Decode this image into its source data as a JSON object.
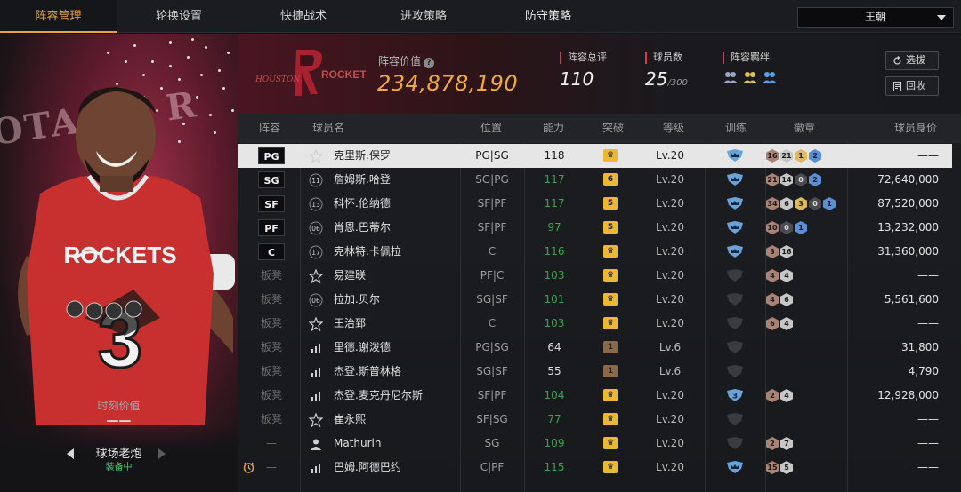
{
  "nav": {
    "tabs": [
      "阵容管理",
      "轮换设置",
      "快捷战术",
      "进攻策略",
      "防守策略"
    ],
    "active_tab": 0,
    "team_select": "王朝"
  },
  "player_card": {
    "background_text": "OTA CE   R",
    "jersey_text": "ROCKETS",
    "jersey_number": "3",
    "moment_value_label": "时刻价值",
    "moment_value": "——",
    "card_name": "球场老炮",
    "status": "装备中"
  },
  "team_header": {
    "logo_text": "HOUSTON ROCKETS",
    "lineup_value_label": "阵容价值",
    "lineup_value": "234,878,190",
    "overall_label": "阵容总评",
    "overall_value": "110",
    "players_label": "球员数",
    "players_value": "25",
    "players_max": "/300",
    "chemistry_label": "阵容羁绊",
    "scout_button": "选拔",
    "recycle_button": "回收"
  },
  "table": {
    "headers": {
      "slot": "阵容",
      "name": "球员名",
      "position": "位置",
      "ability": "能力",
      "breakthrough": "突破",
      "level": "等级",
      "training": "训练",
      "badges": "徽章",
      "value": "球员身价"
    },
    "rows": [
      {
        "slot": "PG",
        "starter": true,
        "tier": "star",
        "name": "克里斯.保罗",
        "pos": "PG|SG",
        "ovr": "118",
        "ovr_color": "white",
        "brk": "crown",
        "brk_color": "gold",
        "lvl": "Lv.20",
        "trn": "crown",
        "badges": [
          [
            "16",
            "b-bronze"
          ],
          [
            "21",
            "b-silver"
          ],
          [
            "1",
            "b-gold"
          ],
          [
            "2",
            "b-blue"
          ]
        ],
        "value": "——",
        "selected": true
      },
      {
        "slot": "SG",
        "starter": true,
        "tier": "11",
        "name": "詹姆斯.哈登",
        "pos": "SG|PG",
        "ovr": "117",
        "ovr_color": "green",
        "brk": "6",
        "brk_color": "gold",
        "lvl": "Lv.20",
        "trn": "crown",
        "badges": [
          [
            "21",
            "b-bronze"
          ],
          [
            "14",
            "b-silver"
          ],
          [
            "0",
            "b-dark"
          ],
          [
            "2",
            "b-blue"
          ]
        ],
        "value": "72,640,000"
      },
      {
        "slot": "SF",
        "starter": true,
        "tier": "13",
        "name": "科怀.伦纳德",
        "pos": "SF|PF",
        "ovr": "117",
        "ovr_color": "green",
        "brk": "5",
        "brk_color": "gold",
        "lvl": "Lv.20",
        "trn": "crown",
        "badges": [
          [
            "34",
            "b-bronze"
          ],
          [
            "6",
            "b-silver"
          ],
          [
            "3",
            "b-gold"
          ],
          [
            "0",
            "b-dark"
          ],
          [
            "1",
            "b-blue"
          ]
        ],
        "value": "87,520,000"
      },
      {
        "slot": "PF",
        "starter": true,
        "tier": "06",
        "name": "肖恩.巴蒂尔",
        "pos": "SF|PF",
        "ovr": "97",
        "ovr_color": "green",
        "brk": "5",
        "brk_color": "gold",
        "lvl": "Lv.20",
        "trn": "crown",
        "badges": [
          [
            "10",
            "b-bronze"
          ],
          [
            "0",
            "b-dark"
          ],
          [
            "1",
            "b-blue"
          ]
        ],
        "value": "13,232,000"
      },
      {
        "slot": "C",
        "starter": true,
        "tier": "17",
        "name": "克林特.卡佩拉",
        "pos": "C",
        "ovr": "116",
        "ovr_color": "green",
        "brk": "crown",
        "brk_color": "gold",
        "lvl": "Lv.20",
        "trn": "crown",
        "badges": [
          [
            "3",
            "b-bronze"
          ],
          [
            "16",
            "b-silver"
          ]
        ],
        "value": "31,360,000"
      },
      {
        "slot": "板凳",
        "starter": false,
        "tier": "star",
        "name": "易建联",
        "pos": "PF|C",
        "ovr": "103",
        "ovr_color": "green",
        "brk": "crown",
        "brk_color": "gold",
        "lvl": "Lv.20",
        "trn": "empty",
        "badges": [
          [
            "4",
            "b-bronze"
          ],
          [
            "4",
            "b-silver"
          ]
        ],
        "value": "——"
      },
      {
        "slot": "板凳",
        "starter": false,
        "tier": "06",
        "name": "拉加.贝尔",
        "pos": "SG|SF",
        "ovr": "101",
        "ovr_color": "green",
        "brk": "crown",
        "brk_color": "gold",
        "lvl": "Lv.20",
        "trn": "empty",
        "badges": [
          [
            "4",
            "b-bronze"
          ],
          [
            "6",
            "b-silver"
          ]
        ],
        "value": "5,561,600"
      },
      {
        "slot": "板凳",
        "starter": false,
        "tier": "star",
        "name": "王治郅",
        "pos": "C",
        "ovr": "103",
        "ovr_color": "green",
        "brk": "crown",
        "brk_color": "gold",
        "lvl": "Lv.20",
        "trn": "empty",
        "badges": [
          [
            "6",
            "b-bronze"
          ],
          [
            "4",
            "b-silver"
          ]
        ],
        "value": "——"
      },
      {
        "slot": "板凳",
        "starter": false,
        "tier": "bars",
        "name": "里德.谢泼德",
        "pos": "PG|SG",
        "ovr": "64",
        "ovr_color": "white",
        "brk": "1",
        "brk_color": "brown",
        "lvl": "Lv.6",
        "trn": "empty",
        "badges": [],
        "value": "31,800"
      },
      {
        "slot": "板凳",
        "starter": false,
        "tier": "bars",
        "name": "杰登.斯普林格",
        "pos": "SG|SF",
        "ovr": "55",
        "ovr_color": "white",
        "brk": "1",
        "brk_color": "brown",
        "lvl": "Lv.6",
        "trn": "empty",
        "badges": [],
        "value": "4,790"
      },
      {
        "slot": "板凳",
        "starter": false,
        "tier": "bars",
        "name": "杰登.麦克丹尼尔斯",
        "pos": "SF|PF",
        "ovr": "104",
        "ovr_color": "green",
        "brk": "crown",
        "brk_color": "gold",
        "lvl": "Lv.20",
        "trn": "3",
        "badges": [
          [
            "2",
            "b-bronze"
          ],
          [
            "4",
            "b-silver"
          ]
        ],
        "value": "12,928,000"
      },
      {
        "slot": "板凳",
        "starter": false,
        "tier": "star",
        "name": "崔永熙",
        "pos": "SF|SG",
        "ovr": "77",
        "ovr_color": "green",
        "brk": "crown",
        "brk_color": "gold",
        "lvl": "Lv.20",
        "trn": "empty",
        "badges": [],
        "value": "——"
      },
      {
        "slot": "—",
        "starter": false,
        "tier": "person",
        "name": "Mathurin",
        "pos": "SG",
        "ovr": "109",
        "ovr_color": "green",
        "brk": "crown",
        "brk_color": "gold",
        "lvl": "Lv.20",
        "trn": "empty",
        "badges": [
          [
            "2",
            "b-bronze"
          ],
          [
            "7",
            "b-silver"
          ]
        ],
        "value": "——"
      },
      {
        "slot": "—",
        "starter": false,
        "tier": "bars",
        "name": "巴姆.阿德巴约",
        "pos": "C|PF",
        "ovr": "115",
        "ovr_color": "green",
        "brk": "crown",
        "brk_color": "gold",
        "lvl": "Lv.20",
        "trn": "crown",
        "badges": [
          [
            "15",
            "b-bronze"
          ],
          [
            "5",
            "b-silver"
          ]
        ],
        "value": "——",
        "alarm": true
      }
    ]
  },
  "colors": {
    "accent": "#e8a63a",
    "green_rating": "#3ea34f",
    "red_marker": "#d33b48",
    "training_blue": "#6aa3d8"
  }
}
